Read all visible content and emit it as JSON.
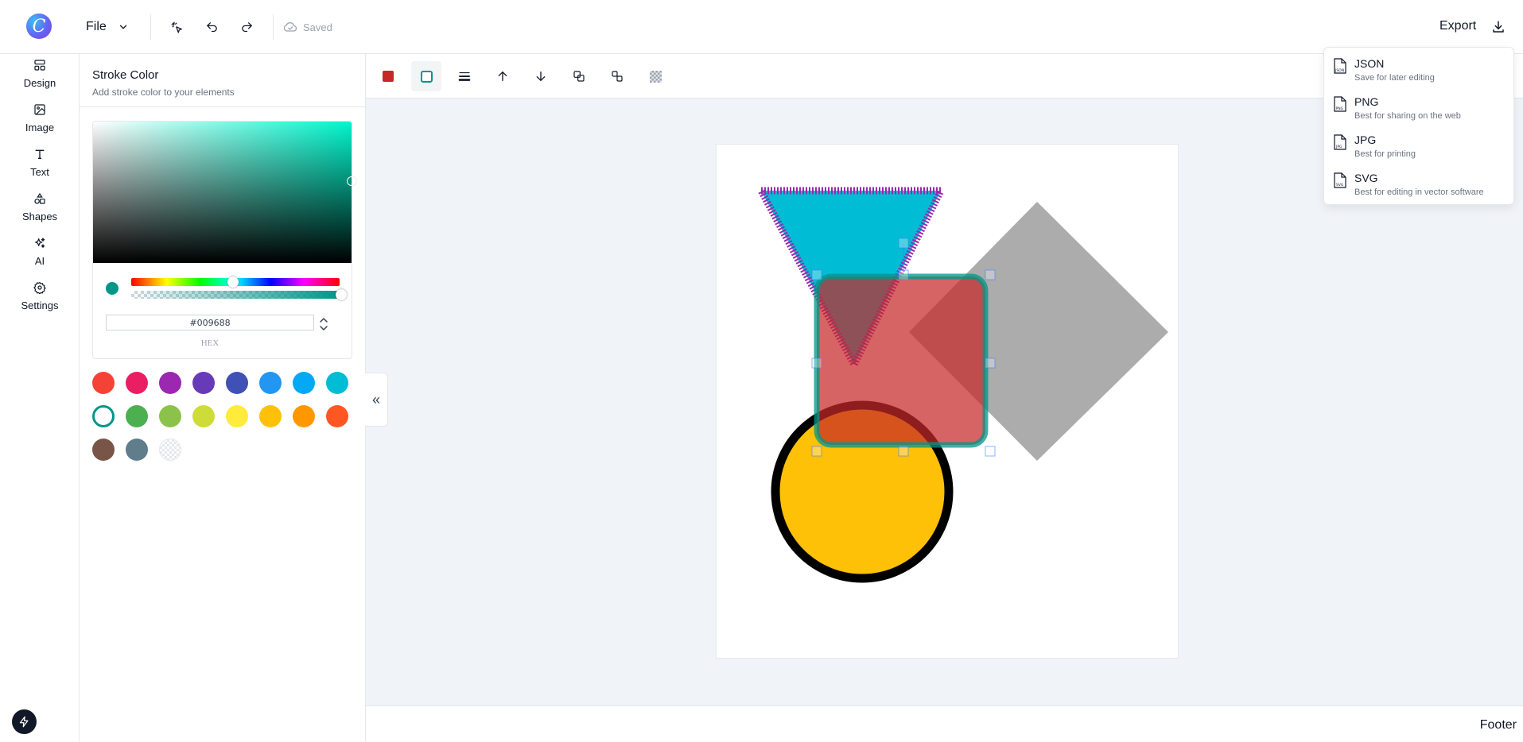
{
  "topbar": {
    "file_label": "File",
    "saved_label": "Saved",
    "export_label": "Export"
  },
  "nav": {
    "items": [
      {
        "label": "Design",
        "icon": "layout-icon"
      },
      {
        "label": "Image",
        "icon": "image-icon"
      },
      {
        "label": "Text",
        "icon": "text-icon"
      },
      {
        "label": "Shapes",
        "icon": "shapes-icon"
      },
      {
        "label": "AI",
        "icon": "sparkles-icon"
      },
      {
        "label": "Settings",
        "icon": "gear-icon"
      }
    ]
  },
  "panel": {
    "title": "Stroke Color",
    "subtitle": "Add stroke color to your elements",
    "hex_value": "#009688",
    "hex_label": "HEX",
    "selected_color": "#009688",
    "swatches": [
      "#f44336",
      "#e91e63",
      "#9c27b0",
      "#673ab7",
      "#3f51b5",
      "#2196f3",
      "#03a9f4",
      "#00bcd4",
      "#009688",
      "#4caf50",
      "#8bc34a",
      "#cddc39",
      "#ffeb3b",
      "#ffc107",
      "#ff9800",
      "#ff5722",
      "#795548",
      "#607d8b",
      "transparent"
    ]
  },
  "export_menu": {
    "items": [
      {
        "title": "JSON",
        "desc": "Save for later editing",
        "tag": "JSON"
      },
      {
        "title": "PNG",
        "desc": "Best for sharing on the web",
        "tag": "PNG"
      },
      {
        "title": "JPG",
        "desc": "Best for printing",
        "tag": "JPG"
      },
      {
        "title": "SVG",
        "desc": "Best for editing in vector software",
        "tag": "SVG"
      }
    ]
  },
  "canvas": {
    "shapes": [
      {
        "kind": "triangle",
        "fill": "#00bcd4",
        "stroke": "#9c27b0"
      },
      {
        "kind": "diamond",
        "fill": "#9e9e9e"
      },
      {
        "kind": "circle",
        "fill": "#ffc107",
        "stroke": "#000000"
      },
      {
        "kind": "rounded-square",
        "fill": "#c62828",
        "stroke": "#009688",
        "selected": true
      }
    ]
  },
  "footer": {
    "label": "Footer"
  }
}
